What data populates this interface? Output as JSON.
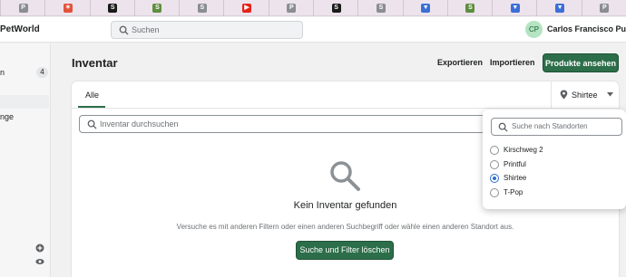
{
  "store": {
    "name": "PetWorld"
  },
  "topbar": {
    "search_placeholder": "Suchen",
    "user_initials": "CP",
    "user_name": "Carlos Francisco Pum..."
  },
  "tabstrip": {
    "icons": [
      {
        "name": "parking-icon",
        "glyph": "P",
        "color": "#8a8d91"
      },
      {
        "name": "nbc-icon",
        "glyph": "✶",
        "color": "#e2523a"
      },
      {
        "name": "shopify-icon",
        "glyph": "S",
        "color": "#1a1a1a"
      },
      {
        "name": "shopify-icon",
        "glyph": "S",
        "color": "#5e8e3e"
      },
      {
        "name": "s-icon",
        "glyph": "S",
        "color": "#8a8d91"
      },
      {
        "name": "youtube-icon",
        "glyph": "▶",
        "color": "#e62117"
      },
      {
        "name": "parking-icon",
        "glyph": "P",
        "color": "#8a8d91"
      },
      {
        "name": "shopify-icon",
        "glyph": "S",
        "color": "#1a1a1a"
      },
      {
        "name": "s-icon",
        "glyph": "S",
        "color": "#8a8d91"
      },
      {
        "name": "shield-icon",
        "glyph": "▼",
        "color": "#3b6fd6"
      },
      {
        "name": "shopify-icon",
        "glyph": "S",
        "color": "#5e8e3e"
      },
      {
        "name": "shield-icon",
        "glyph": "▼",
        "color": "#3b6fd6"
      },
      {
        "name": "shield-icon",
        "glyph": "▼",
        "color": "#3b6fd6"
      },
      {
        "name": "parking-icon",
        "glyph": "P",
        "color": "#8a8d91"
      }
    ]
  },
  "sidebar": {
    "item_partial_label": "n",
    "item_count": "4",
    "item_partial_label_2": "nge"
  },
  "page": {
    "title": "Inventar",
    "export_label": "Exportieren",
    "import_label": "Importieren",
    "view_products_label": "Produkte ansehen"
  },
  "card": {
    "tab_all": "Alle",
    "location_selected": "Shirtee",
    "search_placeholder": "Inventar durchsuchen",
    "empty_title": "Kein Inventar gefunden",
    "empty_desc": "Versuche es mit anderen Filtern oder einen anderen Suchbegriff oder wähle einen anderen Standort aus.",
    "clear_button": "Suche und Filter löschen"
  },
  "popover": {
    "search_placeholder": "Suche nach Standorten",
    "locations": [
      {
        "label": "Kirschweg 2",
        "checked": false
      },
      {
        "label": "Printful",
        "checked": false
      },
      {
        "label": "Shirtee",
        "checked": true
      },
      {
        "label": "T-Pop",
        "checked": false
      }
    ]
  },
  "colors": {
    "primary": "#2c6e49",
    "radio_selected": "#2c6ecb"
  }
}
